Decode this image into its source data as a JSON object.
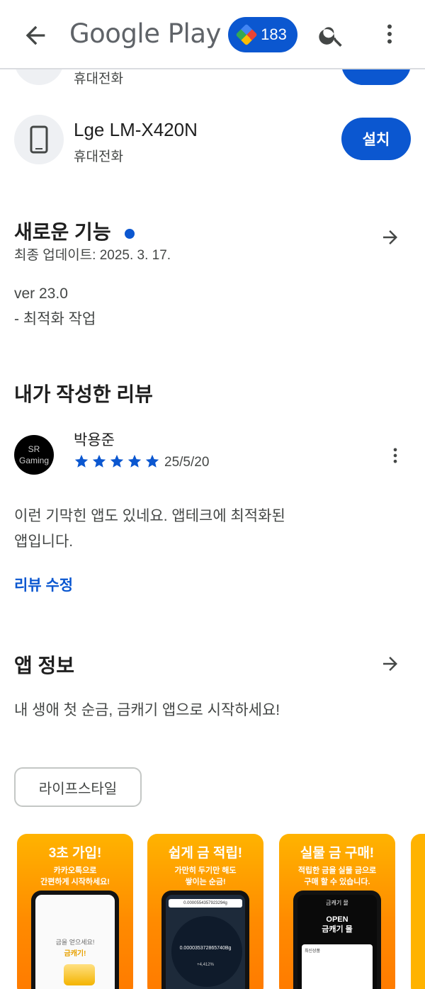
{
  "appbar": {
    "logo_text": "Google Play",
    "points": "183"
  },
  "devices": [
    {
      "name": "",
      "type": "휴대전화",
      "button": ""
    },
    {
      "name": "Lge LM-X420N",
      "type": "휴대전화",
      "button": "설치"
    }
  ],
  "whats_new": {
    "title": "새로운 기능",
    "updated": "최종 업데이트: 2025. 3. 17.",
    "version": "ver 23.0",
    "note": "- 최적화 작업"
  },
  "my_review": {
    "title": "내가 작성한 리뷰",
    "reviewer": "박용준",
    "avatar_line1": "SR",
    "avatar_line2": "Gaming",
    "rating": 5,
    "date": "25/5/20",
    "text_line1": "이런 기막힌 앱도 있네요. 앱테크에 최적화된",
    "text_line2": "앱입니다.",
    "edit_label": "리뷰 수정"
  },
  "app_info": {
    "title": "앱 정보",
    "description": "내 생애 첫 순금, 금캐기 앱으로 시작하세요!",
    "category_chip": "라이프스타일"
  },
  "screenshots": [
    {
      "headline": "3초 가입!",
      "sub1": "카카오톡으로",
      "sub2": "간편하게 시작하세요!",
      "screen_line1": "금을 얻으세요!",
      "screen_line2": "금캐기!"
    },
    {
      "headline": "쉽게 금 적립!",
      "sub1": "가만히 두기만 해도",
      "sub2": "쌓이는 순금!",
      "screen_bar": "0.0000554357923294g",
      "screen_value": "0.000035372865740Bg",
      "screen_sub": "+4,412%"
    },
    {
      "headline": "실물 금 구매!",
      "sub1": "적립한 금을 실물 금으로",
      "sub2": "구매 할 수 있습니다.",
      "screen_top": "금캐기 몰",
      "screen_open1": "OPEN",
      "screen_open2": "금캐기 몰",
      "screen_label": "최신상품"
    }
  ],
  "colors": {
    "accent": "#0b57d0",
    "star": "#0b57d0",
    "screenshot_orange": "#ff8a00"
  }
}
